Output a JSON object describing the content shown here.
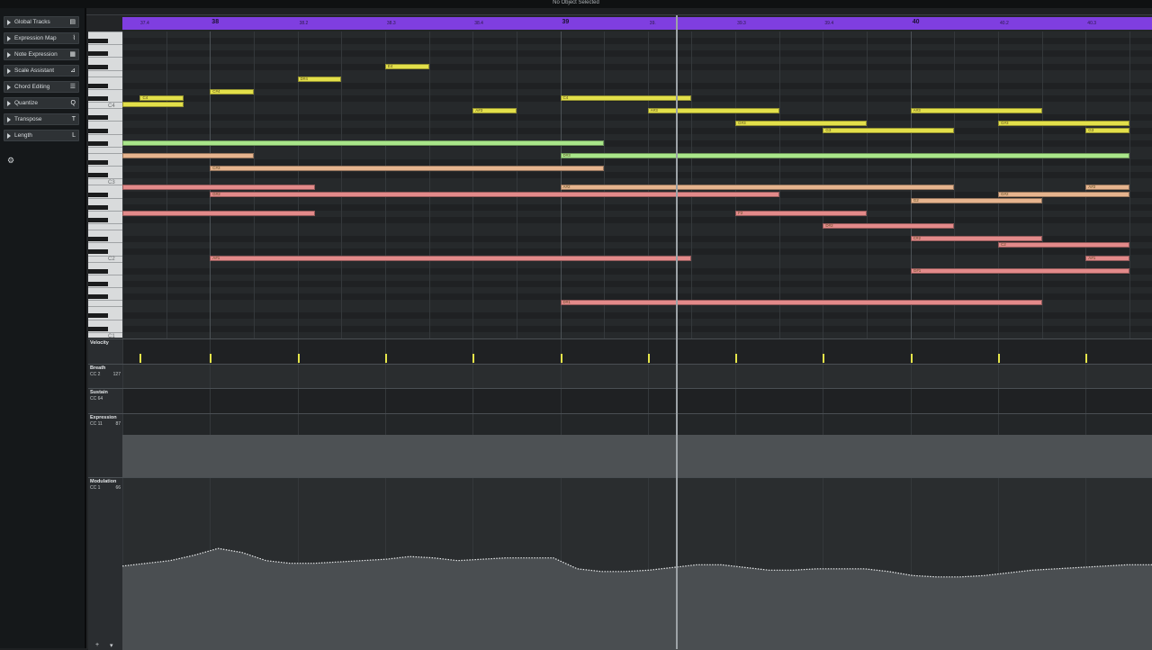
{
  "window": {
    "title": "No Object Selected"
  },
  "inspector": {
    "items": [
      {
        "label": "Global Tracks",
        "icon": "list-icon"
      },
      {
        "label": "Expression Map",
        "icon": "curve-icon"
      },
      {
        "label": "Note Expression",
        "icon": "grid-icon"
      },
      {
        "label": "Scale Assistant",
        "icon": "scale-icon"
      },
      {
        "label": "Chord Editing",
        "icon": "bars-icon"
      },
      {
        "label": "Quantize",
        "icon": "q-icon"
      },
      {
        "label": "Transpose",
        "icon": "t-icon"
      },
      {
        "label": "Length",
        "icon": "l-icon"
      }
    ],
    "icon_glyphs": [
      "▤",
      "⌇",
      "▦",
      "⊿",
      "☰",
      "Q",
      "T",
      "L"
    ],
    "settings_glyph": "⚙"
  },
  "ruler": {
    "labels": [
      {
        "text": "37.4",
        "kind": "beat",
        "pos": 0.0
      },
      {
        "text": "38",
        "kind": "bar",
        "pos": 1.0
      },
      {
        "text": "38.2",
        "kind": "beat",
        "pos": 2.0
      },
      {
        "text": "38.3",
        "kind": "beat",
        "pos": 3.0
      },
      {
        "text": "38.4",
        "kind": "beat",
        "pos": 4.0
      },
      {
        "text": "39",
        "kind": "bar",
        "pos": 5.0
      },
      {
        "text": "39.",
        "kind": "beat",
        "pos": 6.0
      },
      {
        "text": "39.3",
        "kind": "beat",
        "pos": 7.0
      },
      {
        "text": "39.4",
        "kind": "beat",
        "pos": 8.0
      },
      {
        "text": "40",
        "kind": "bar",
        "pos": 9.0
      },
      {
        "text": "40.2",
        "kind": "beat",
        "pos": 10.0
      },
      {
        "text": "40.3",
        "kind": "beat",
        "pos": 11.0
      }
    ]
  },
  "keyboard": {
    "labels": [
      "C4",
      "C3",
      "C2",
      "C1"
    ]
  },
  "notes": [
    {
      "name": "C4",
      "row": 10,
      "start": 0.2,
      "end": 0.7,
      "color": "#e3e04a"
    },
    {
      "name": "",
      "row": 11,
      "start": 0.0,
      "end": 0.7,
      "color": "#e3e04a"
    },
    {
      "name": "C#4",
      "row": 9,
      "start": 1.0,
      "end": 1.5,
      "color": "#e3e04a"
    },
    {
      "name": "D#4",
      "row": 7,
      "start": 2.0,
      "end": 2.5,
      "color": "#e3e04a"
    },
    {
      "name": "E4",
      "row": 5,
      "start": 3.0,
      "end": 3.5,
      "color": "#e3e04a"
    },
    {
      "name": "A#3",
      "row": 12,
      "start": 4.0,
      "end": 4.5,
      "color": "#e3e04a"
    },
    {
      "name": "C4",
      "row": 10,
      "start": 5.0,
      "end": 6.5,
      "color": "#e3e04a"
    },
    {
      "name": "A#3",
      "row": 12,
      "start": 6.0,
      "end": 7.5,
      "color": "#e3e04a"
    },
    {
      "name": "G#3",
      "row": 14,
      "start": 7.0,
      "end": 8.5,
      "color": "#e3e04a"
    },
    {
      "name": "G3",
      "row": 15,
      "start": 8.0,
      "end": 9.5,
      "color": "#e3e04a"
    },
    {
      "name": "A#3",
      "row": 12,
      "start": 9.0,
      "end": 10.5,
      "color": "#e3e04a"
    },
    {
      "name": "G#3",
      "row": 14,
      "start": 10.0,
      "end": 11.5,
      "color": "#e3e04a"
    },
    {
      "name": "G3",
      "row": 15,
      "start": 11.0,
      "end": 11.5,
      "color": "#e3e04a"
    },
    {
      "name": "",
      "row": 17,
      "start": 0.0,
      "end": 5.5,
      "color": "#a9e68a"
    },
    {
      "name": "D#3",
      "row": 19,
      "start": 5.0,
      "end": 11.5,
      "color": "#a9e68a"
    },
    {
      "name": "",
      "row": 19,
      "start": 0.0,
      "end": 1.5,
      "color": "#e6b48e"
    },
    {
      "name": "C#3",
      "row": 21,
      "start": 1.0,
      "end": 5.5,
      "color": "#e6b48e"
    },
    {
      "name": "A#2",
      "row": 24,
      "start": 5.0,
      "end": 9.5,
      "color": "#e6b48e"
    },
    {
      "name": "G#2",
      "row": 25,
      "start": 10.0,
      "end": 11.5,
      "color": "#e6b48e"
    },
    {
      "name": "G2",
      "row": 26,
      "start": 9.0,
      "end": 10.5,
      "color": "#e6b48e"
    },
    {
      "name": "A#2",
      "row": 24,
      "start": 11.0,
      "end": 11.5,
      "color": "#e6b48e"
    },
    {
      "name": "",
      "row": 24,
      "start": 0.0,
      "end": 2.2,
      "color": "#e38a8a"
    },
    {
      "name": "G#2",
      "row": 25,
      "start": 1.0,
      "end": 7.5,
      "color": "#e38a8a"
    },
    {
      "name": "",
      "row": 28,
      "start": 0.0,
      "end": 2.2,
      "color": "#e38a8a"
    },
    {
      "name": "F2",
      "row": 28,
      "start": 7.0,
      "end": 8.5,
      "color": "#e38a8a"
    },
    {
      "name": "D#2",
      "row": 30,
      "start": 8.0,
      "end": 9.5,
      "color": "#e38a8a"
    },
    {
      "name": "C#2",
      "row": 32,
      "start": 9.0,
      "end": 10.5,
      "color": "#e38a8a"
    },
    {
      "name": "C2",
      "row": 33,
      "start": 10.0,
      "end": 11.5,
      "color": "#e38a8a"
    },
    {
      "name": "A#1",
      "row": 35,
      "start": 1.0,
      "end": 6.5,
      "color": "#e38a8a"
    },
    {
      "name": "A#1",
      "row": 35,
      "start": 11.0,
      "end": 11.5,
      "color": "#e38a8a"
    },
    {
      "name": "G#1",
      "row": 37,
      "start": 9.0,
      "end": 11.5,
      "color": "#e38a8a"
    },
    {
      "name": "D#1",
      "row": 42,
      "start": 5.0,
      "end": 10.5,
      "color": "#e38a8a"
    }
  ],
  "lanes": [
    {
      "name": "Velocity",
      "cc": "",
      "value": ""
    },
    {
      "name": "Breath",
      "cc": "CC 2",
      "value": "127"
    },
    {
      "name": "Sustain",
      "cc": "CC 64",
      "value": ""
    },
    {
      "name": "Expression",
      "cc": "CC 11",
      "value": "87"
    },
    {
      "name": "Modulation",
      "cc": "CC 1",
      "value": "66"
    }
  ],
  "velocity_beats": [
    0.2,
    1.0,
    2.0,
    3.0,
    4.0,
    5.0,
    6.0,
    7.0,
    8.0,
    9.0,
    10.0,
    11.0
  ],
  "modulation_curve": [
    62,
    64,
    66,
    70,
    75,
    72,
    66,
    64,
    64,
    65,
    66,
    67,
    69,
    68,
    66,
    67,
    68,
    68,
    68,
    60,
    58,
    58,
    59,
    61,
    63,
    63,
    61,
    59,
    59,
    60,
    60,
    60,
    58,
    55,
    54,
    54,
    55,
    57,
    59,
    60,
    61,
    62,
    63,
    63
  ],
  "bottom": {
    "plus": "+",
    "dropdown": "▾"
  }
}
